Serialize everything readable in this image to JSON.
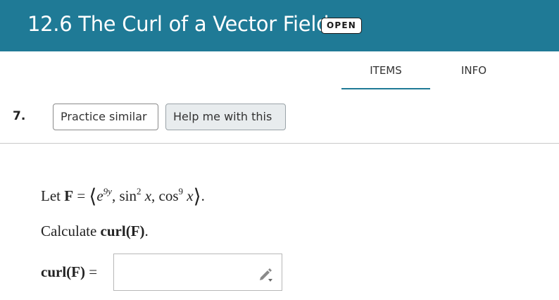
{
  "header": {
    "title": "12.6 The Curl of a Vector Field",
    "status_badge": "OPEN",
    "background_color": "#1f7a96"
  },
  "tabs": [
    {
      "label": "ITEMS",
      "active": true
    },
    {
      "label": "INFO",
      "active": false
    }
  ],
  "question": {
    "number": "7.",
    "buttons": {
      "practice_similar": "Practice similar",
      "help_me": "Help me with this"
    },
    "statement": {
      "let": "Let",
      "F": "F",
      "eq": "=",
      "comp1_base": "e",
      "comp1_exp": "9y",
      "comp2_fn": "sin",
      "comp2_exp": "2",
      "comp2_var": "x",
      "comp3_fn": "cos",
      "comp3_exp": "9",
      "comp3_var": "x"
    },
    "prompt": {
      "text": "Calculate",
      "expr": "curl(F)",
      "end": "."
    },
    "answer": {
      "label": "curl(F)",
      "eq": "=",
      "value": "",
      "icon": "pencil-icon"
    }
  }
}
